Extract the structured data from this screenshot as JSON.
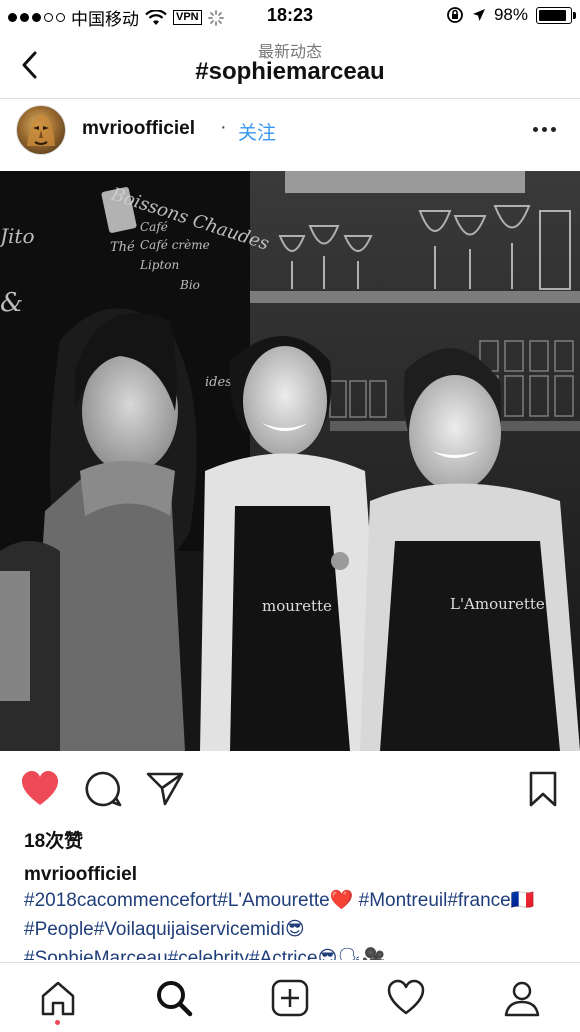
{
  "status_bar": {
    "carrier": "中国移动",
    "vpn": "VPN",
    "time": "18:23",
    "battery_percent": "98%",
    "battery_level": 0.98
  },
  "nav": {
    "subtitle": "最新动态",
    "title": "#sophiemarceau"
  },
  "post": {
    "username": "mvrioofficiel",
    "separator": "·",
    "follow_label": "关注",
    "photo_signs": {
      "chalkboard_heading": "Boissons Chaudes",
      "apron_text_left": "mourette",
      "apron_text_right": "L'Amourette"
    },
    "likes": "18次赞",
    "caption_user": "mvrioofficiel",
    "caption_line1": "#2018cacommencefort#L'Amourette❤️ #Montreuil#france🇫🇷 #People#Voilaquijaiservicemidi😎",
    "caption_line3": "#SophieMarceau#celebrity#Actrice😎🗣🎥"
  },
  "colors": {
    "like_heart": "#ed4956",
    "follow": "#3897f0",
    "hashtag": "#1f3e7a"
  },
  "icons": {
    "like": "heart-icon",
    "comment": "comment-icon",
    "share": "share-icon",
    "save": "bookmark-icon",
    "home": "home-icon",
    "search": "search-icon",
    "add": "add-post-icon",
    "activity": "heart-outline-icon",
    "profile": "profile-icon"
  }
}
